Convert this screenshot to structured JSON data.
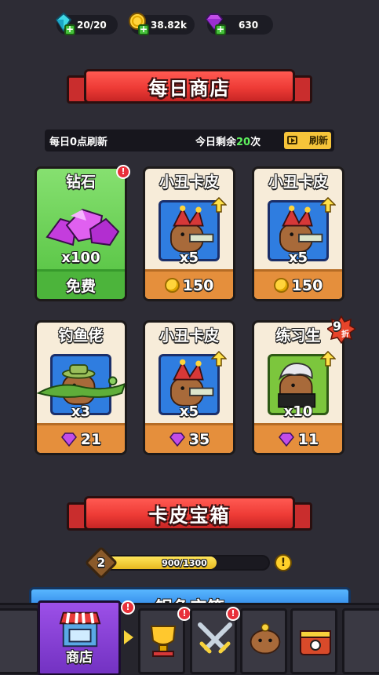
{
  "resources": {
    "energy": {
      "value": "20/20",
      "icon": "energy-gem-icon"
    },
    "gold": {
      "value": "38.82k",
      "icon": "gold-coin-icon"
    },
    "gems": {
      "value": "630",
      "icon": "purple-gem-icon"
    }
  },
  "daily_shop": {
    "title": "每日商店",
    "refresh_note": "每日0点刷新",
    "remaining_prefix": "今日剩余",
    "remaining_count": "20",
    "remaining_suffix": "次",
    "refresh_button": "刷新"
  },
  "cards": [
    {
      "title": "钻石",
      "qty": "x100",
      "price": "免费",
      "currency": "free",
      "badge": "!"
    },
    {
      "title": "小丑卡皮",
      "qty": "x5",
      "price": "150",
      "currency": "coin"
    },
    {
      "title": "小丑卡皮",
      "qty": "x5",
      "price": "150",
      "currency": "coin"
    },
    {
      "title": "钓鱼佬",
      "qty": "x3",
      "price": "21",
      "currency": "gem"
    },
    {
      "title": "小丑卡皮",
      "qty": "x5",
      "price": "35",
      "currency": "gem"
    },
    {
      "title": "练习生",
      "qty": "x10",
      "price": "11",
      "currency": "gem",
      "discount_num": "9",
      "discount_unit": "折"
    }
  ],
  "skin_chest": {
    "title": "卡皮宝箱",
    "level": "2",
    "progress_text": "900/1300",
    "progress_fraction": 0.6923,
    "info": "!",
    "next_bar_text": "银色宝箱"
  },
  "nav": {
    "shop_label": "商店",
    "badge": "!"
  },
  "colors": {
    "background": "#2d2c35",
    "banner_red": "#ee3b36",
    "card_cream": "#f7ecd9",
    "price_orange": "#e58f3c",
    "free_green": "#4cb43b",
    "active_tab_purple": "#8a42d8",
    "remaining_green": "#5ef05e"
  }
}
